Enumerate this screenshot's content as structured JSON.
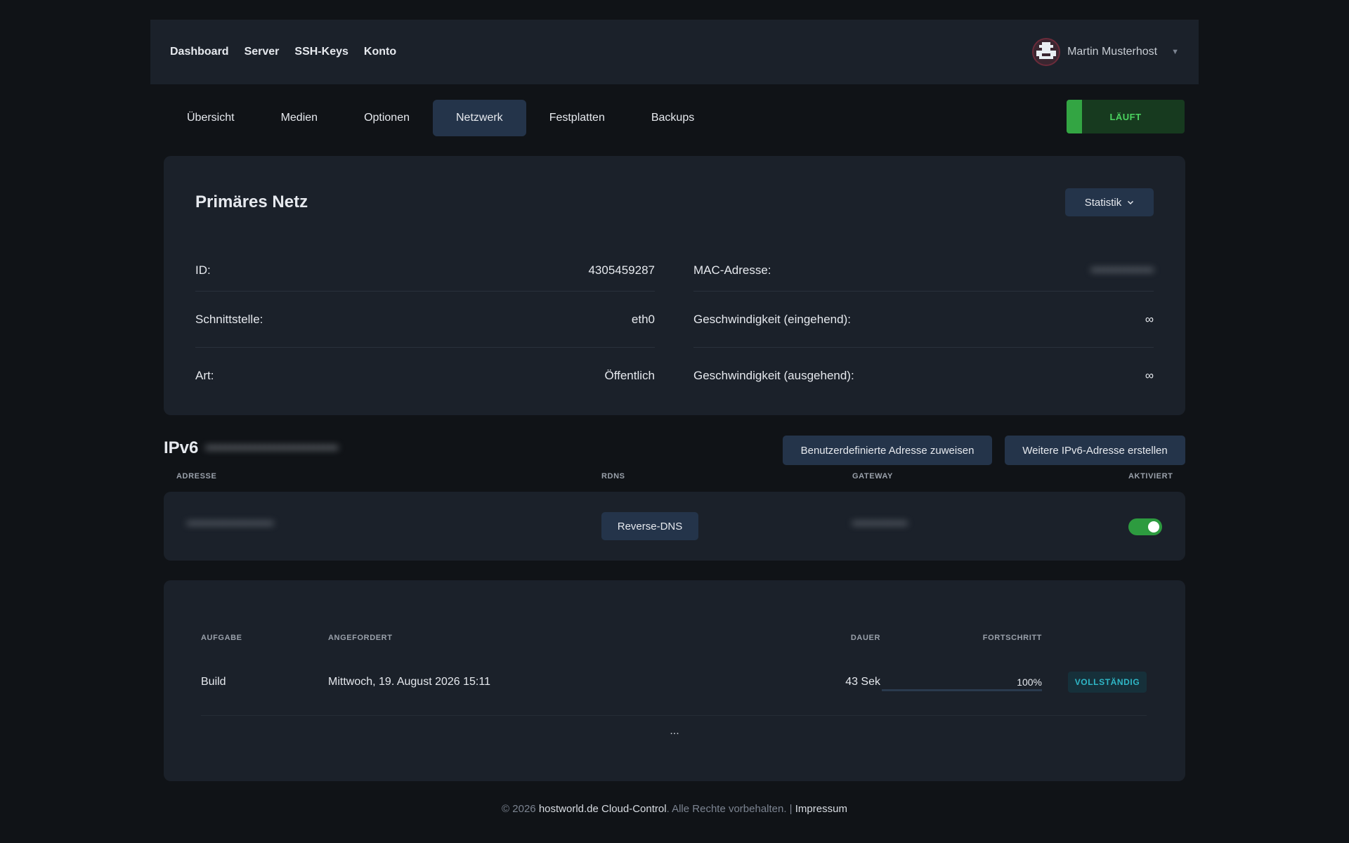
{
  "topbar": {
    "nav": [
      "Dashboard",
      "Server",
      "SSH-Keys",
      "Konto"
    ],
    "user_name": "Martin Musterhost"
  },
  "tabs": [
    {
      "label": "Übersicht",
      "active": false
    },
    {
      "label": "Medien",
      "active": false
    },
    {
      "label": "Optionen",
      "active": false
    },
    {
      "label": "Netzwerk",
      "active": true
    },
    {
      "label": "Festplatten",
      "active": false
    },
    {
      "label": "Backups",
      "active": false
    }
  ],
  "status_label": "LÄUFT",
  "network": {
    "title": "Primäres Netz",
    "stats_button": "Statistik",
    "id_label": "ID:",
    "id_value": "4305459287",
    "interface_label": "Schnittstelle:",
    "interface_value": "eth0",
    "type_label": "Art:",
    "type_value": "Öffentlich",
    "mac_label": "MAC-Adresse:",
    "mac_value": "•••••••••••••••",
    "speed_in_label": "Geschwindigkeit (eingehend):",
    "speed_in_value": "∞",
    "speed_out_label": "Geschwindigkeit (ausgehend):",
    "speed_out_value": "∞"
  },
  "ipv6": {
    "title": "IPv6",
    "subnet_value": "•••••••••••••••••••••••••••",
    "assign_button": "Benutzerdefinierte Adresse zuweisen",
    "create_button": "Weitere IPv6-Adresse erstellen",
    "col_address": "ADRESSE",
    "col_rdns": "RDNS",
    "col_gateway": "GATEWAY",
    "col_enabled": "AKTIVIERT",
    "row_address": "••••••••••••••••••••••",
    "rdns_button": "Reverse-DNS",
    "row_gateway": "••••••••••••••",
    "enabled": true
  },
  "tasks": {
    "col_task": "AUFGABE",
    "col_requested": "ANGEFORDERT",
    "col_duration": "DAUER",
    "col_progress": "FORTSCHRITT",
    "row_task": "Build",
    "row_requested": "Mittwoch, 19. August 2026 15:11",
    "row_duration": "43 Sek",
    "row_progress_pct": "100%",
    "row_progress": 1.0,
    "row_status": "VOLLSTÄNDIG",
    "more": "..."
  },
  "footer": {
    "copyright": "© 2026",
    "brand": "hostworld.de Cloud-Control",
    "rights": ". Alle Rechte vorbehalten. |",
    "impressum": "Impressum"
  }
}
